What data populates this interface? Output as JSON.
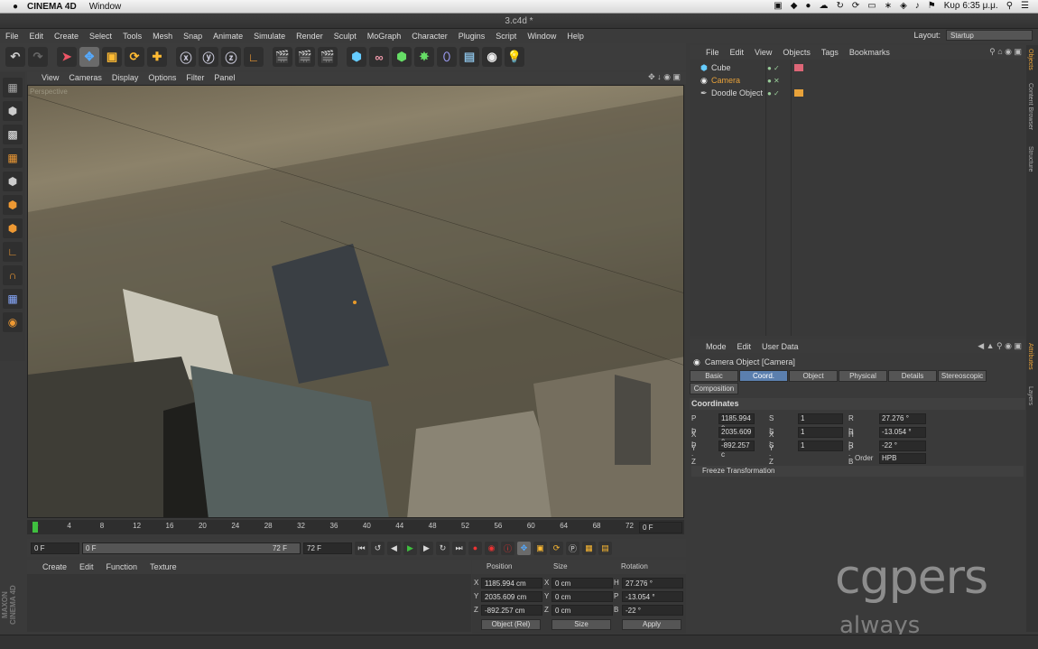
{
  "mac": {
    "apple": "",
    "app": "CINEMA 4D",
    "window_menu": "Window",
    "clock": "Κυρ 6:35 μ.μ."
  },
  "window": {
    "title": "3.c4d *"
  },
  "menu": [
    "File",
    "Edit",
    "Create",
    "Select",
    "Tools",
    "Mesh",
    "Snap",
    "Animate",
    "Simulate",
    "Render",
    "Sculpt",
    "MoGraph",
    "Character",
    "Plugins",
    "Script",
    "Window",
    "Help"
  ],
  "layout": {
    "label": "Layout:",
    "value": "Startup"
  },
  "viewport": {
    "menu": [
      "View",
      "Cameras",
      "Display",
      "Options",
      "Filter",
      "Panel"
    ],
    "label": "Perspective"
  },
  "timeline": {
    "ticks": [
      "0",
      "4",
      "8",
      "12",
      "16",
      "20",
      "24",
      "28",
      "32",
      "36",
      "40",
      "44",
      "48",
      "52",
      "56",
      "60",
      "64",
      "68",
      "72"
    ],
    "current": "0 F",
    "start": "0 F",
    "range_start": "0 F",
    "range_end": "72 F",
    "end": "72 F"
  },
  "material_manager": {
    "menu": [
      "Create",
      "Edit",
      "Function",
      "Texture"
    ]
  },
  "maxon_logo": "MAXON CINEMA 4D",
  "coord_manager": {
    "headers": [
      "Position",
      "Size",
      "Rotation"
    ],
    "rows": [
      {
        "axis": "X",
        "pos": "1185.994 cm",
        "size_axis": "X",
        "size": "0 cm",
        "rot_axis": "H",
        "rot": "27.276 °"
      },
      {
        "axis": "Y",
        "pos": "2035.609 cm",
        "size_axis": "Y",
        "size": "0 cm",
        "rot_axis": "P",
        "rot": "-13.054 °"
      },
      {
        "axis": "Z",
        "pos": "-892.257 cm",
        "size_axis": "Z",
        "size": "0 cm",
        "rot_axis": "B",
        "rot": "-22 °"
      }
    ],
    "mode": "Object (Rel)",
    "size_mode": "Size",
    "apply": "Apply"
  },
  "object_manager": {
    "menu": [
      "File",
      "Edit",
      "View",
      "Objects",
      "Tags",
      "Bookmarks"
    ],
    "objects": [
      {
        "name": "Cube",
        "color": "#dddddd"
      },
      {
        "name": "Camera",
        "color": "#e8a23a"
      },
      {
        "name": "Doodle Object",
        "color": "#dddddd"
      }
    ]
  },
  "side_tabs": [
    "Objects",
    "Content Browser",
    "Structure",
    "Attributes",
    "Layers"
  ],
  "attribute_manager": {
    "menu": [
      "Mode",
      "Edit",
      "User Data"
    ],
    "title": "Camera Object [Camera]",
    "tabs": [
      "Basic",
      "Coord.",
      "Object",
      "Physical",
      "Details",
      "Stereoscopic",
      "Composition"
    ],
    "active_tab": "Coord.",
    "section": "Coordinates",
    "rows": [
      {
        "p_lbl": "P . X",
        "p": "1185.994 c",
        "s_lbl": "S . X",
        "s": "1",
        "r_lbl": "R . H",
        "r": "27.276 °"
      },
      {
        "p_lbl": "P . Y",
        "p": "2035.609 c",
        "s_lbl": "S . Y",
        "s": "1",
        "r_lbl": "R . P",
        "r": "-13.054 °"
      },
      {
        "p_lbl": "P . Z",
        "p": "-892.257 c",
        "s_lbl": "S . Z",
        "s": "1",
        "r_lbl": "R . B",
        "r": "-22 °"
      }
    ],
    "order_label": "Order",
    "order_value": "HPB",
    "freeze": "Freeze Transformation"
  },
  "watermark": {
    "brand": "cgpers",
    "sub": "always"
  },
  "colors": {
    "accent": "#5b7fae",
    "play_green": "#3fbf3f",
    "record_red": "#c0392b"
  }
}
